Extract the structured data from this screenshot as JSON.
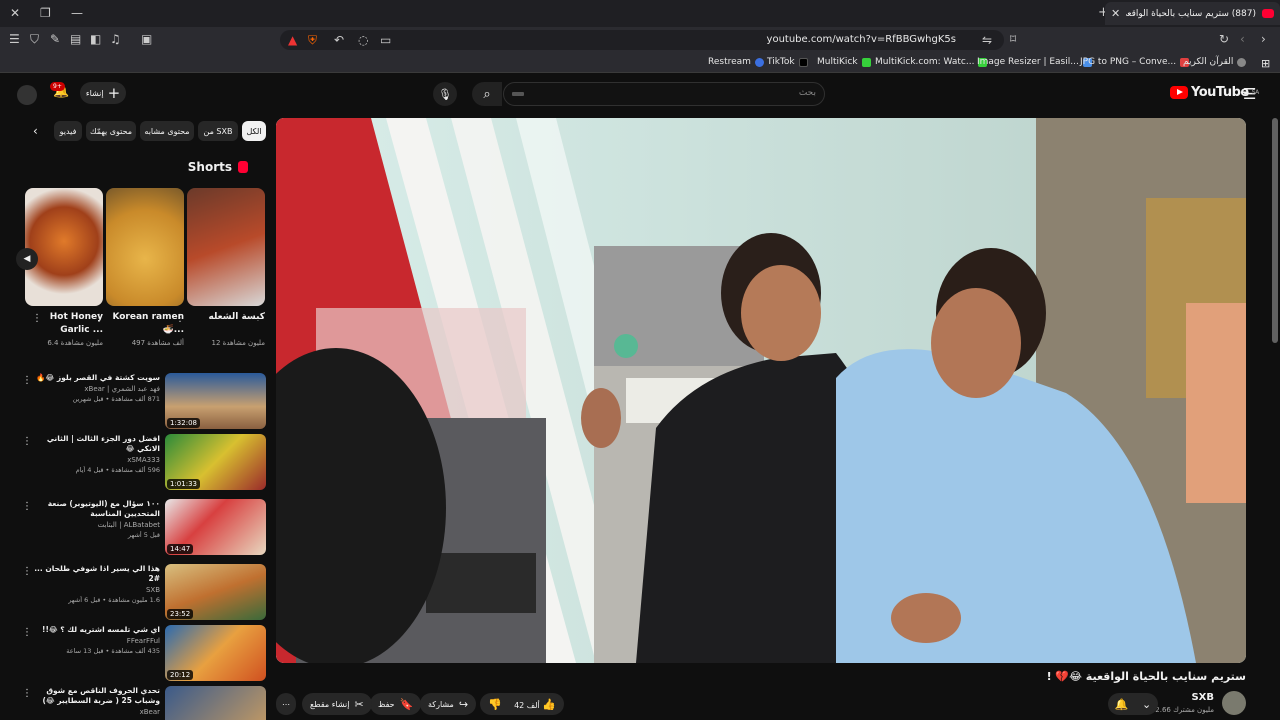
{
  "browser": {
    "tab_title": "(887) ستريم سنايب بالحياة الواقعي",
    "url": "youtube.com/watch?v=RfBBGwhgK5s",
    "bookmarks": [
      "Restream",
      "TikTok",
      "MultiKick",
      "MultiKick.com: Watc...",
      "Image Resizer | Easil...",
      "JPG to PNG – Conve...",
      "القرآن الكريم"
    ]
  },
  "header": {
    "logo": "YouTube",
    "region": "SA",
    "search_placeholder": "بحث",
    "create_label": "إنشاء",
    "notification_count": "9+"
  },
  "chips": [
    "الكل",
    "من SXB",
    "محتوى مشابه",
    "محتوى يهمّك",
    "فيديو"
  ],
  "shorts": {
    "title": "Shorts",
    "items": [
      {
        "title": "كبسة الشعله",
        "views": "12 مليون مشاهدة"
      },
      {
        "title": "Korean ramen 🍜...",
        "views": "497 ألف مشاهدة"
      },
      {
        "title": "Hot Honey Garlic ...",
        "views": "6.4 مليون مشاهدة"
      }
    ]
  },
  "recommendations": [
    {
      "title": "سويت كشتة في القصر بلوز 😂🔥",
      "channel": "فهد عبد الشمري | xBear",
      "meta": "871 ألف مشاهدة • قبل شهرين",
      "duration": "1:32:08"
    },
    {
      "title": "افضل دور الجزء الثالث | الثاني الانكي 😂",
      "channel": "xSMA333",
      "meta": "596 ألف مشاهدة • قبل 4 أيام",
      "duration": "1:01:33"
    },
    {
      "title": "١٠٠ سؤال مع (اليوتيوبر) صنعة المتحديين المناسبة",
      "channel": "ALBatabet | البتابت",
      "meta": "قبل 5 أشهر",
      "duration": "14:47"
    },
    {
      "title": "هذا الي يسير اذا شوفي طلحان ... #2",
      "channel": "SXB",
      "meta": "1.6 مليون مشاهدة • قبل 6 أشهر",
      "duration": "23:52"
    },
    {
      "title": "اي شي تلمسه اشتريه لك ؟ 😂!!",
      "channel": "FFearFFul",
      "meta": "435 ألف مشاهدة • قبل 13 ساعة",
      "duration": "20:12"
    },
    {
      "title": "تحدي الحروف الناقص مع شوق وشباب 25 ( ضربة السطايبر 😂)",
      "channel": "xBear",
      "meta": "",
      "duration": ""
    }
  ],
  "video": {
    "title": "ستريم سنايب بالحياة الواقعية 😂💔 !",
    "channel": "SXB",
    "subscribers": "2.66 مليون مشترك",
    "likes": "42 ألف",
    "share_label": "مشاركة",
    "save_label": "حفظ",
    "clip_label": "إنشاء مقطع"
  },
  "colors": {
    "accent": "#ff0000",
    "background": "#0f0f0f",
    "chip": "#272727"
  }
}
